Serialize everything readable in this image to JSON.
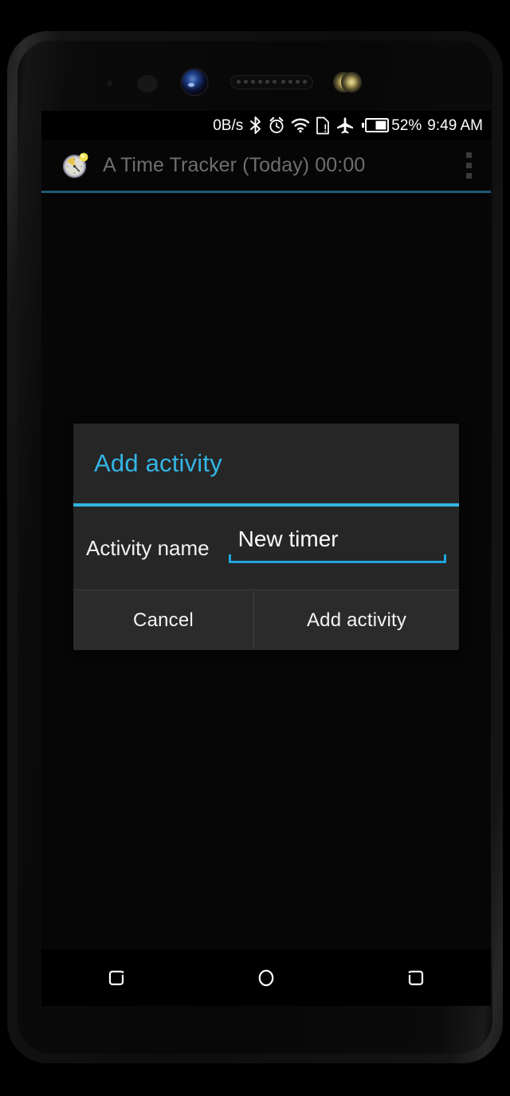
{
  "device": {
    "hardware": {
      "notification_led": "notification-led",
      "proximity_sensor": "proximity-sensor",
      "front_camera": "front-camera",
      "earpiece_speaker": "earpiece-speaker",
      "front_flash": "front-dual-led-flash",
      "volume_button": "volume-rocker",
      "power_button": "power-button"
    }
  },
  "status_bar": {
    "network_speed": "0B/s",
    "icons": [
      {
        "name": "bluetooth-icon",
        "label": "Bluetooth"
      },
      {
        "name": "alarm-icon",
        "label": "Alarm set"
      },
      {
        "name": "wifi-icon",
        "label": "Wi-Fi connected"
      },
      {
        "name": "no-sim-icon",
        "label": "No SIM card"
      },
      {
        "name": "airplane-mode-icon",
        "label": "Airplane mode"
      },
      {
        "name": "battery-icon",
        "label": "Battery"
      }
    ],
    "battery_percent": "52%",
    "battery_level": 52,
    "clock": "9:49 AM"
  },
  "action_bar": {
    "app_icon": "stopwatch-icon",
    "title": "A Time Tracker (Today) 00:00",
    "overflow_menu": "overflow-menu"
  },
  "dialog": {
    "title": "Add activity",
    "field": {
      "label": "Activity name",
      "value": "New timer",
      "placeholder": "New timer"
    },
    "buttons": {
      "negative": "Cancel",
      "positive": "Add activity"
    }
  },
  "nav_bar": {
    "recents": "recents-button",
    "home": "home-button",
    "back": "back-button"
  },
  "colors": {
    "accent_blue": "#33b5e5",
    "edit_underline": "#1ea6dd",
    "action_bar_underline": "#1f5a70",
    "dialog_bg": "#262626",
    "button_bg": "#2b2b2b",
    "title_text": "#6e6e6e"
  }
}
